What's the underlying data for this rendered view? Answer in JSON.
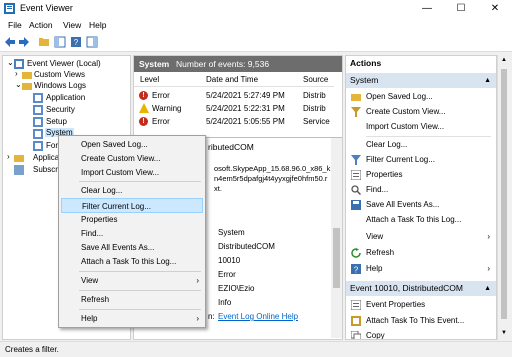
{
  "window": {
    "title": "Event Viewer",
    "minimize": "—",
    "maximize": "☐",
    "close": "✕"
  },
  "menu": {
    "file": "File",
    "action": "Action",
    "view": "View",
    "help": "Help"
  },
  "tree": {
    "root": "Event Viewer (Local)",
    "custom_views": "Custom Views",
    "windows_logs": "Windows Logs",
    "application": "Application",
    "security": "Security",
    "setup": "Setup",
    "system": "System",
    "forwarded": "Forw",
    "apps": "Applicati",
    "subs": "Subscri"
  },
  "center": {
    "log_name": "System",
    "event_count": "Number of events: 9,536",
    "columns": {
      "level": "Level",
      "date": "Date and Time",
      "source": "Source"
    },
    "rows": [
      {
        "level": "Error",
        "date": "5/24/2021 5:27:49 PM",
        "source": "Distrib"
      },
      {
        "level": "Warning",
        "date": "5/24/2021 5:22:31 PM",
        "source": "Distrib"
      },
      {
        "level": "Error",
        "date": "5/24/2021 5:05:55 PM",
        "source": "Service"
      }
    ],
    "detail_title": "ributedCOM",
    "detail_line1": "osoft.SkypeApp_15.68.96.0_x86_k",
    "detail_line2": "n4em5r5dpafgj4t4yyxgjfe0hfm50.r",
    "detail_line3": "xt.",
    "detail_values": [
      "System",
      "DistributedCOM",
      "10010",
      "Error",
      "EZIO\\Ezio",
      "Info"
    ],
    "detail_link_prefix": "n:",
    "detail_link": "Event Log Online Help"
  },
  "actions": {
    "header": "Actions",
    "section1": "System",
    "items1": [
      {
        "icon": "folder-open-icon",
        "label": "Open Saved Log..."
      },
      {
        "icon": "filter-icon",
        "label": "Create Custom View..."
      },
      {
        "icon": "",
        "label": "Import Custom View..."
      },
      {
        "icon": "",
        "label": "Clear Log..."
      },
      {
        "icon": "filter-icon",
        "label": "Filter Current Log..."
      },
      {
        "icon": "properties-icon",
        "label": "Properties"
      },
      {
        "icon": "find-icon",
        "label": "Find..."
      },
      {
        "icon": "save-icon",
        "label": "Save All Events As..."
      },
      {
        "icon": "",
        "label": "Attach a Task To this Log..."
      },
      {
        "icon": "",
        "label": "View"
      },
      {
        "icon": "refresh-icon",
        "label": "Refresh"
      },
      {
        "icon": "help-icon",
        "label": "Help"
      }
    ],
    "section2": "Event 10010, DistributedCOM",
    "items2": [
      {
        "icon": "properties-icon",
        "label": "Event Properties"
      },
      {
        "icon": "task-icon",
        "label": "Attach Task To This Event..."
      },
      {
        "icon": "copy-icon",
        "label": "Copy"
      }
    ]
  },
  "context_menu": {
    "items": [
      "Open Saved Log...",
      "Create Custom View...",
      "Import Custom View...",
      "Clear Log...",
      "Filter Current Log...",
      "Properties",
      "Find...",
      "Save All Events As...",
      "Attach a Task To this Log...",
      "View",
      "Refresh",
      "Help"
    ],
    "highlighted": "Filter Current Log..."
  },
  "status": "Creates a filter.",
  "colors": {
    "header": "#6d6d6d",
    "section_bg": "#d9e4f1",
    "highlight": "#cce8ff",
    "error": "#c42b1c",
    "warning": "#e8b400"
  }
}
